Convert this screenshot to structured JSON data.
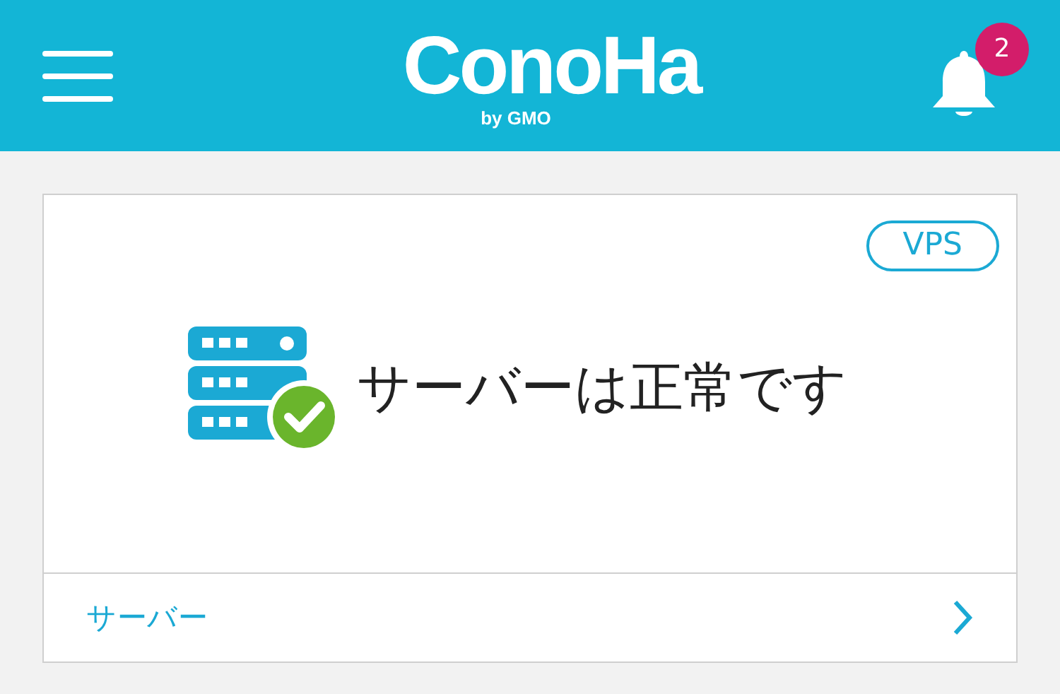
{
  "header": {
    "logo": "ConoHa",
    "logo_byline": "by GMO",
    "notifications": "2"
  },
  "card": {
    "tag": "VPS",
    "status": {
      "kind": "ok",
      "message": "サーバーは正常です"
    },
    "link": "サーバー"
  }
}
